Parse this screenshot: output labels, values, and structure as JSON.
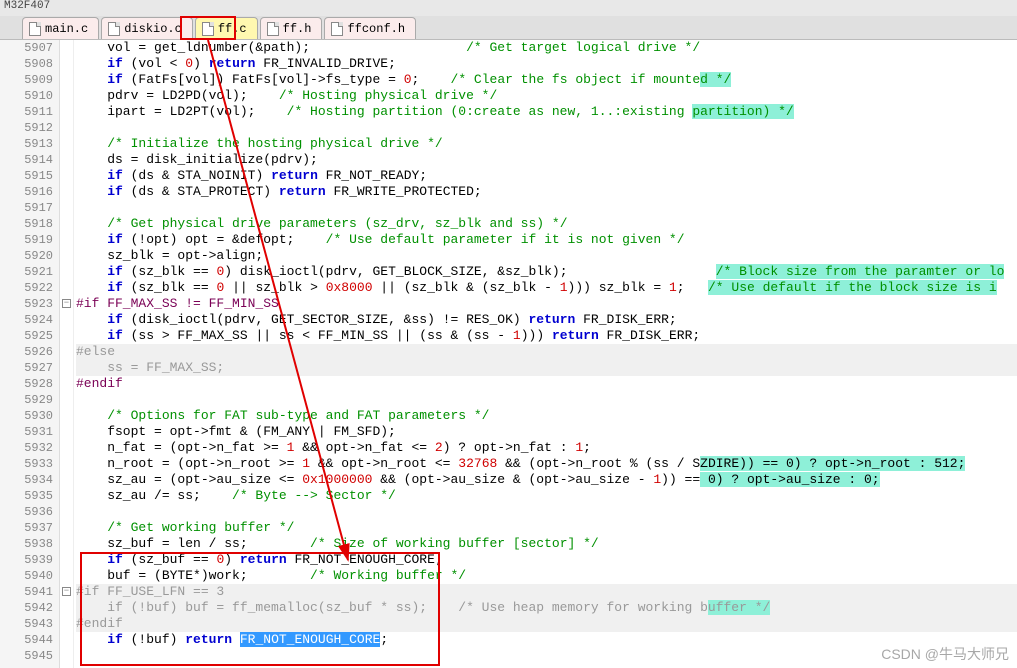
{
  "window_title": "M32F407",
  "tabs": [
    {
      "label": "main.c",
      "active": false
    },
    {
      "label": "diskio.c",
      "active": false
    },
    {
      "label": "ff.c",
      "active": true
    },
    {
      "label": "ff.h",
      "active": false
    },
    {
      "label": "ffconf.h",
      "active": false
    }
  ],
  "line_start": 5907,
  "lines": [
    {
      "n": 5907,
      "seg": [
        {
          "t": "    vol = get_ldnumber(&path);",
          "c": "ident"
        },
        {
          "t": "                    ",
          "c": "ident"
        },
        {
          "t": "/* Get target logical drive */",
          "c": "cm"
        }
      ]
    },
    {
      "n": 5908,
      "seg": [
        {
          "t": "    ",
          "c": "ident"
        },
        {
          "t": "if",
          "c": "kw"
        },
        {
          "t": " (vol < ",
          "c": "ident"
        },
        {
          "t": "0",
          "c": "num"
        },
        {
          "t": ") ",
          "c": "ident"
        },
        {
          "t": "return",
          "c": "kw"
        },
        {
          "t": " FR_INVALID_DRIVE;",
          "c": "ident"
        }
      ]
    },
    {
      "n": 5909,
      "seg": [
        {
          "t": "    ",
          "c": "ident"
        },
        {
          "t": "if",
          "c": "kw"
        },
        {
          "t": " (FatFs[vol]) FatFs[vol]->fs_type = ",
          "c": "ident"
        },
        {
          "t": "0",
          "c": "num"
        },
        {
          "t": ";    ",
          "c": "ident"
        },
        {
          "t": "/* Clear the fs object if mounte",
          "c": "cm"
        },
        {
          "t": "d */",
          "c": "cm hl1"
        }
      ]
    },
    {
      "n": 5910,
      "seg": [
        {
          "t": "    pdrv = LD2PD(vol);    ",
          "c": "ident"
        },
        {
          "t": "/* Hosting physical drive */",
          "c": "cm"
        }
      ]
    },
    {
      "n": 5911,
      "seg": [
        {
          "t": "    ipart = LD2PT(vol);    ",
          "c": "ident"
        },
        {
          "t": "/* Hosting partition (0:create as new, 1..:existing ",
          "c": "cm"
        },
        {
          "t": "partition) */",
          "c": "cm hl1"
        }
      ]
    },
    {
      "n": 5912,
      "seg": [
        {
          "t": "",
          "c": "ident"
        }
      ]
    },
    {
      "n": 5913,
      "seg": [
        {
          "t": "    ",
          "c": "ident"
        },
        {
          "t": "/* Initialize the hosting physical drive */",
          "c": "cm"
        }
      ]
    },
    {
      "n": 5914,
      "seg": [
        {
          "t": "    ds = disk_initialize(pdrv);",
          "c": "ident"
        }
      ]
    },
    {
      "n": 5915,
      "seg": [
        {
          "t": "    ",
          "c": "ident"
        },
        {
          "t": "if",
          "c": "kw"
        },
        {
          "t": " (ds & STA_NOINIT) ",
          "c": "ident"
        },
        {
          "t": "return",
          "c": "kw"
        },
        {
          "t": " FR_NOT_READY;",
          "c": "ident"
        }
      ]
    },
    {
      "n": 5916,
      "seg": [
        {
          "t": "    ",
          "c": "ident"
        },
        {
          "t": "if",
          "c": "kw"
        },
        {
          "t": " (ds & STA_PROTECT) ",
          "c": "ident"
        },
        {
          "t": "return",
          "c": "kw"
        },
        {
          "t": " FR_WRITE_PROTECTED;",
          "c": "ident"
        }
      ]
    },
    {
      "n": 5917,
      "seg": [
        {
          "t": "",
          "c": "ident"
        }
      ]
    },
    {
      "n": 5918,
      "seg": [
        {
          "t": "    ",
          "c": "ident"
        },
        {
          "t": "/* Get physical drive parameters (sz_drv, sz_blk and ss) */",
          "c": "cm"
        }
      ]
    },
    {
      "n": 5919,
      "seg": [
        {
          "t": "    ",
          "c": "ident"
        },
        {
          "t": "if",
          "c": "kw"
        },
        {
          "t": " (!opt) opt = &defopt;    ",
          "c": "ident"
        },
        {
          "t": "/* Use default parameter if it is not given */",
          "c": "cm"
        }
      ]
    },
    {
      "n": 5920,
      "seg": [
        {
          "t": "    sz_blk = opt->align;",
          "c": "ident"
        }
      ]
    },
    {
      "n": 5921,
      "seg": [
        {
          "t": "    ",
          "c": "ident"
        },
        {
          "t": "if",
          "c": "kw"
        },
        {
          "t": " (sz_blk == ",
          "c": "ident"
        },
        {
          "t": "0",
          "c": "num"
        },
        {
          "t": ") disk_ioctl(pdrv, GET_BLOCK_SIZE, &sz_blk);                   ",
          "c": "ident"
        },
        {
          "t": "/* Block size from the paramter or lo",
          "c": "cm hl1"
        }
      ]
    },
    {
      "n": 5922,
      "seg": [
        {
          "t": "    ",
          "c": "ident"
        },
        {
          "t": "if",
          "c": "kw"
        },
        {
          "t": " (sz_blk == ",
          "c": "ident"
        },
        {
          "t": "0",
          "c": "num"
        },
        {
          "t": " || sz_blk > ",
          "c": "ident"
        },
        {
          "t": "0x8000",
          "c": "num"
        },
        {
          "t": " || (sz_blk & (sz_blk - ",
          "c": "ident"
        },
        {
          "t": "1",
          "c": "num"
        },
        {
          "t": "))) sz_blk = ",
          "c": "ident"
        },
        {
          "t": "1",
          "c": "num"
        },
        {
          "t": ";   ",
          "c": "ident"
        },
        {
          "t": "/* Use default if the block size is i",
          "c": "cm hl1"
        }
      ]
    },
    {
      "n": 5923,
      "fold": "-",
      "seg": [
        {
          "t": "#if FF_MAX_SS != FF_MIN_SS",
          "c": "const"
        }
      ]
    },
    {
      "n": 5924,
      "seg": [
        {
          "t": "    ",
          "c": "ident"
        },
        {
          "t": "if",
          "c": "kw"
        },
        {
          "t": " (disk_ioctl(pdrv, GET_SECTOR_SIZE, &ss) != RES_OK) ",
          "c": "ident"
        },
        {
          "t": "return",
          "c": "kw"
        },
        {
          "t": " FR_DISK_ERR;",
          "c": "ident"
        }
      ]
    },
    {
      "n": 5925,
      "seg": [
        {
          "t": "    ",
          "c": "ident"
        },
        {
          "t": "if",
          "c": "kw"
        },
        {
          "t": " (ss > FF_MAX_SS || ss < FF_MIN_SS || (ss & (ss - ",
          "c": "ident"
        },
        {
          "t": "1",
          "c": "num"
        },
        {
          "t": "))) ",
          "c": "ident"
        },
        {
          "t": "return",
          "c": "kw"
        },
        {
          "t": " FR_DISK_ERR;",
          "c": "ident"
        }
      ]
    },
    {
      "n": 5926,
      "gray": true,
      "seg": [
        {
          "t": "#else",
          "c": "dim"
        }
      ]
    },
    {
      "n": 5927,
      "gray": true,
      "seg": [
        {
          "t": "    ss = FF_MAX_SS;",
          "c": "dim"
        }
      ]
    },
    {
      "n": 5928,
      "seg": [
        {
          "t": "#endif",
          "c": "const"
        }
      ]
    },
    {
      "n": 5929,
      "seg": [
        {
          "t": "",
          "c": "ident"
        }
      ]
    },
    {
      "n": 5930,
      "seg": [
        {
          "t": "    ",
          "c": "ident"
        },
        {
          "t": "/* Options for FAT sub-type and FAT parameters */",
          "c": "cm"
        }
      ]
    },
    {
      "n": 5931,
      "seg": [
        {
          "t": "    fsopt = opt->fmt & (FM_ANY | FM_SFD);",
          "c": "ident"
        }
      ]
    },
    {
      "n": 5932,
      "seg": [
        {
          "t": "    n_fat = (opt->n_fat >= ",
          "c": "ident"
        },
        {
          "t": "1",
          "c": "num"
        },
        {
          "t": " && opt->n_fat <= ",
          "c": "ident"
        },
        {
          "t": "2",
          "c": "num"
        },
        {
          "t": ") ? opt->n_fat : ",
          "c": "ident"
        },
        {
          "t": "1",
          "c": "num"
        },
        {
          "t": ";",
          "c": "ident"
        }
      ]
    },
    {
      "n": 5933,
      "seg": [
        {
          "t": "    n_root = (opt->n_root >= ",
          "c": "ident"
        },
        {
          "t": "1",
          "c": "num"
        },
        {
          "t": " && opt->n_root <= ",
          "c": "ident"
        },
        {
          "t": "32768",
          "c": "num"
        },
        {
          "t": " && (opt->n_root % (ss / S",
          "c": "ident"
        },
        {
          "t": "ZDIRE)) == 0) ? opt->n_root : 512;",
          "c": "ident hl2"
        }
      ]
    },
    {
      "n": 5934,
      "seg": [
        {
          "t": "    sz_au = (opt->au_size <= ",
          "c": "ident"
        },
        {
          "t": "0x1000000",
          "c": "num"
        },
        {
          "t": " && (opt->au_size & (opt->au_size - ",
          "c": "ident"
        },
        {
          "t": "1",
          "c": "num"
        },
        {
          "t": ")) ==",
          "c": "ident"
        },
        {
          "t": " 0) ? opt->au_size : 0;",
          "c": "ident hl2"
        }
      ]
    },
    {
      "n": 5935,
      "seg": [
        {
          "t": "    sz_au /= ss;    ",
          "c": "ident"
        },
        {
          "t": "/* Byte --> Sector */",
          "c": "cm"
        }
      ]
    },
    {
      "n": 5936,
      "seg": [
        {
          "t": "",
          "c": "ident"
        }
      ]
    },
    {
      "n": 5937,
      "seg": [
        {
          "t": "    ",
          "c": "ident"
        },
        {
          "t": "/* Get working buffer */",
          "c": "cm"
        }
      ]
    },
    {
      "n": 5938,
      "seg": [
        {
          "t": "    sz_buf = len / ss;        ",
          "c": "ident"
        },
        {
          "t": "/* Size of working buffer [sector] */",
          "c": "cm"
        }
      ]
    },
    {
      "n": 5939,
      "seg": [
        {
          "t": "    ",
          "c": "ident"
        },
        {
          "t": "if",
          "c": "kw"
        },
        {
          "t": " (sz_buf == ",
          "c": "ident"
        },
        {
          "t": "0",
          "c": "num"
        },
        {
          "t": ") ",
          "c": "ident"
        },
        {
          "t": "return",
          "c": "kw"
        },
        {
          "t": " FR_NOT_ENOUGH_CORE;",
          "c": "ident"
        }
      ]
    },
    {
      "n": 5940,
      "seg": [
        {
          "t": "    buf = (BYTE*)work;        ",
          "c": "ident"
        },
        {
          "t": "/* Working buffer */",
          "c": "cm"
        }
      ]
    },
    {
      "n": 5941,
      "fold": "-",
      "gray": true,
      "seg": [
        {
          "t": "#if FF_USE_LFN == 3",
          "c": "dim"
        }
      ]
    },
    {
      "n": 5942,
      "gray": true,
      "seg": [
        {
          "t": "    if (!buf) buf = ff_memalloc(sz_buf * ss);    ",
          "c": "dim"
        },
        {
          "t": "/* Use heap memory for working b",
          "c": "dim"
        },
        {
          "t": "uffer */",
          "c": "dim hl1"
        }
      ]
    },
    {
      "n": 5943,
      "gray": true,
      "seg": [
        {
          "t": "#endif",
          "c": "dim"
        }
      ]
    },
    {
      "n": 5944,
      "seg": [
        {
          "t": "    ",
          "c": "ident"
        },
        {
          "t": "if",
          "c": "kw"
        },
        {
          "t": " (!buf) ",
          "c": "ident"
        },
        {
          "t": "return",
          "c": "kw"
        },
        {
          "t": " ",
          "c": "ident"
        },
        {
          "t": "FR_NOT_ENOUGH_CORE",
          "c": "sel"
        },
        {
          "t": ";",
          "c": "ident"
        }
      ]
    },
    {
      "n": 5945,
      "seg": [
        {
          "t": "",
          "c": "ident"
        }
      ]
    }
  ],
  "watermark": "CSDN @牛马大师兄"
}
